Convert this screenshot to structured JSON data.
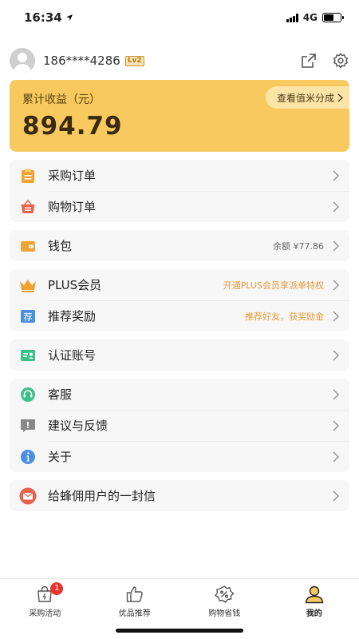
{
  "status": {
    "time": "16:34",
    "network": "4G"
  },
  "profile": {
    "phone": "186****4286",
    "level": "Lv2"
  },
  "earnings": {
    "label": "累计收益（元）",
    "value": "894.79",
    "link": "查看值米分成"
  },
  "groups": [
    [
      {
        "label": "采购订单"
      },
      {
        "label": "购物订单"
      }
    ],
    [
      {
        "label": "钱包",
        "extra": "余额 ¥77.86"
      }
    ],
    [
      {
        "label": "PLUS会员",
        "extra": "开通PLUS会员享派单特权"
      },
      {
        "label": "推荐奖励",
        "extra": "推荐好友，获奖励金"
      }
    ],
    [
      {
        "label": "认证账号"
      }
    ],
    [
      {
        "label": "客服"
      },
      {
        "label": "建议与反馈"
      },
      {
        "label": "关于"
      }
    ],
    [
      {
        "label": "给蜂佣用户的一封信"
      }
    ]
  ],
  "tabbar": [
    {
      "label": "采购活动",
      "badge": "1"
    },
    {
      "label": "优品推荐"
    },
    {
      "label": "购物省钱"
    },
    {
      "label": "我的"
    }
  ],
  "colors": {
    "accent": "#f7c95e",
    "orange_text": "#e39a3b",
    "badge": "#e9342f"
  }
}
